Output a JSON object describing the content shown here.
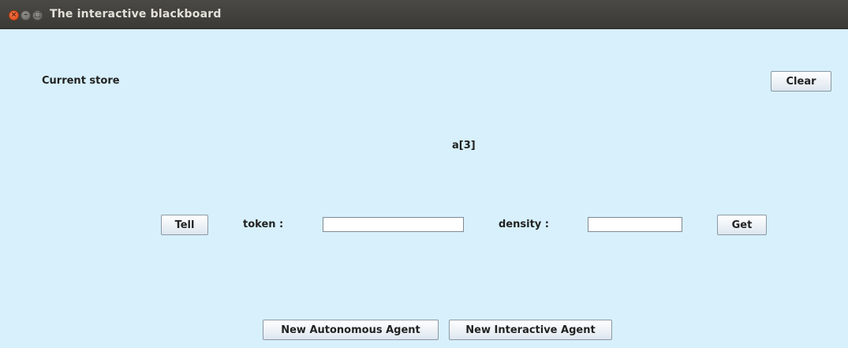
{
  "window": {
    "title": "The interactive blackboard",
    "controls": {
      "close_glyph": "×",
      "minimize_glyph": "–",
      "maximize_glyph": "□"
    }
  },
  "store": {
    "label": "Current store",
    "content": "a[3]",
    "clear_label": "Clear"
  },
  "controls": {
    "tell_label": "Tell",
    "token_label": "token :",
    "token_value": "",
    "density_label": "density :",
    "density_value": "",
    "get_label": "Get"
  },
  "agents": {
    "autonomous_label": "New Autonomous Agent",
    "interactive_label": "New Interactive Agent"
  },
  "colors": {
    "background": "#d7f0fb",
    "titlebar": "#3e3d39",
    "close_button": "#e95420"
  }
}
